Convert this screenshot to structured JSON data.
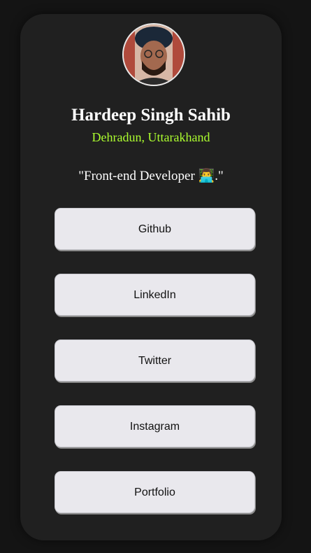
{
  "profile": {
    "name": "Hardeep Singh Sahib",
    "location": "Dehradun, Uttarakhand",
    "bio": "\"Front-end Developer 👨‍💻.\""
  },
  "links": [
    {
      "label": "Github"
    },
    {
      "label": "LinkedIn"
    },
    {
      "label": "Twitter"
    },
    {
      "label": "Instagram"
    },
    {
      "label": "Portfolio"
    }
  ],
  "colors": {
    "page_background": "#141414",
    "card_background": "#202020",
    "location_accent": "#adff2f",
    "button_background": "#e9e8ed"
  }
}
